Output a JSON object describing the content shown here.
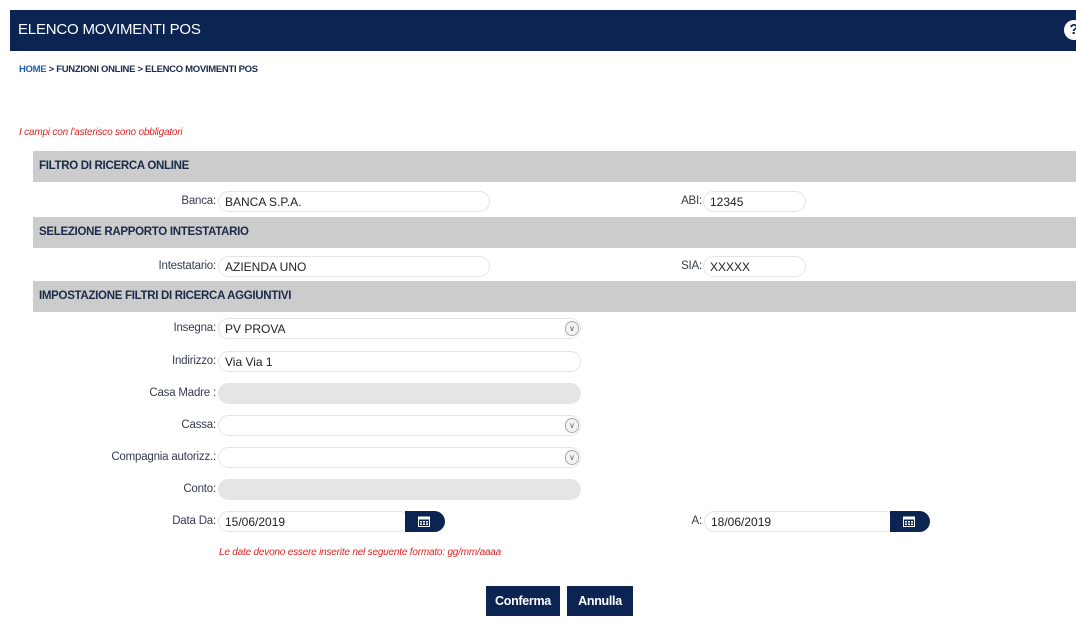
{
  "header": {
    "title": "ELENCO MOVIMENTI POS",
    "help_glyph": "?"
  },
  "breadcrumb": {
    "home": "HOME",
    "rest": " > FUNZIONI ONLINE > ELENCO MOVIMENTI POS"
  },
  "required_note": "I campi con l'asterisco sono obbligatori",
  "sections": {
    "filtro": "FILTRO DI RICERCA ONLINE",
    "rapporto": "SELEZIONE RAPPORTO INTESTATARIO",
    "aggiuntivi": "IMPOSTAZIONE FILTRI DI RICERCA AGGIUNTIVI"
  },
  "fields": {
    "banca": {
      "label": "Banca:",
      "value": "BANCA S.P.A."
    },
    "abi": {
      "label": "ABI:",
      "value": "12345"
    },
    "intestatario": {
      "label": "Intestatario:",
      "value": "AZIENDA UNO"
    },
    "sia": {
      "label": "SIA:",
      "value": "XXXXX"
    },
    "insegna": {
      "label": "Insegna:",
      "value": "PV PROVA"
    },
    "indirizzo": {
      "label": "Indirizzo:",
      "value": "Via Via 1"
    },
    "casa_madre": {
      "label": "Casa Madre :",
      "value": ""
    },
    "cassa": {
      "label": "Cassa:",
      "value": ""
    },
    "compagnia": {
      "label": "Compagnia autorizz.:",
      "value": ""
    },
    "conto": {
      "label": "Conto:",
      "value": ""
    },
    "data_da": {
      "label": "Data Da:",
      "value": "15/06/2019"
    },
    "data_a": {
      "label": "A:",
      "value": "18/06/2019"
    }
  },
  "date_note": "Le date devono essere inserite nel seguente formato: gg/mm/aaaa",
  "buttons": {
    "confirm": "Conferma",
    "cancel": "Annulla"
  },
  "icons": {
    "help": "help-icon",
    "calendar": "calendar-icon",
    "dropdown": "chevron-down-icon"
  },
  "colors": {
    "navy": "#0c2451",
    "section_gray": "#cccccc",
    "error_red": "#e02424",
    "link_blue": "#1f5fae"
  }
}
